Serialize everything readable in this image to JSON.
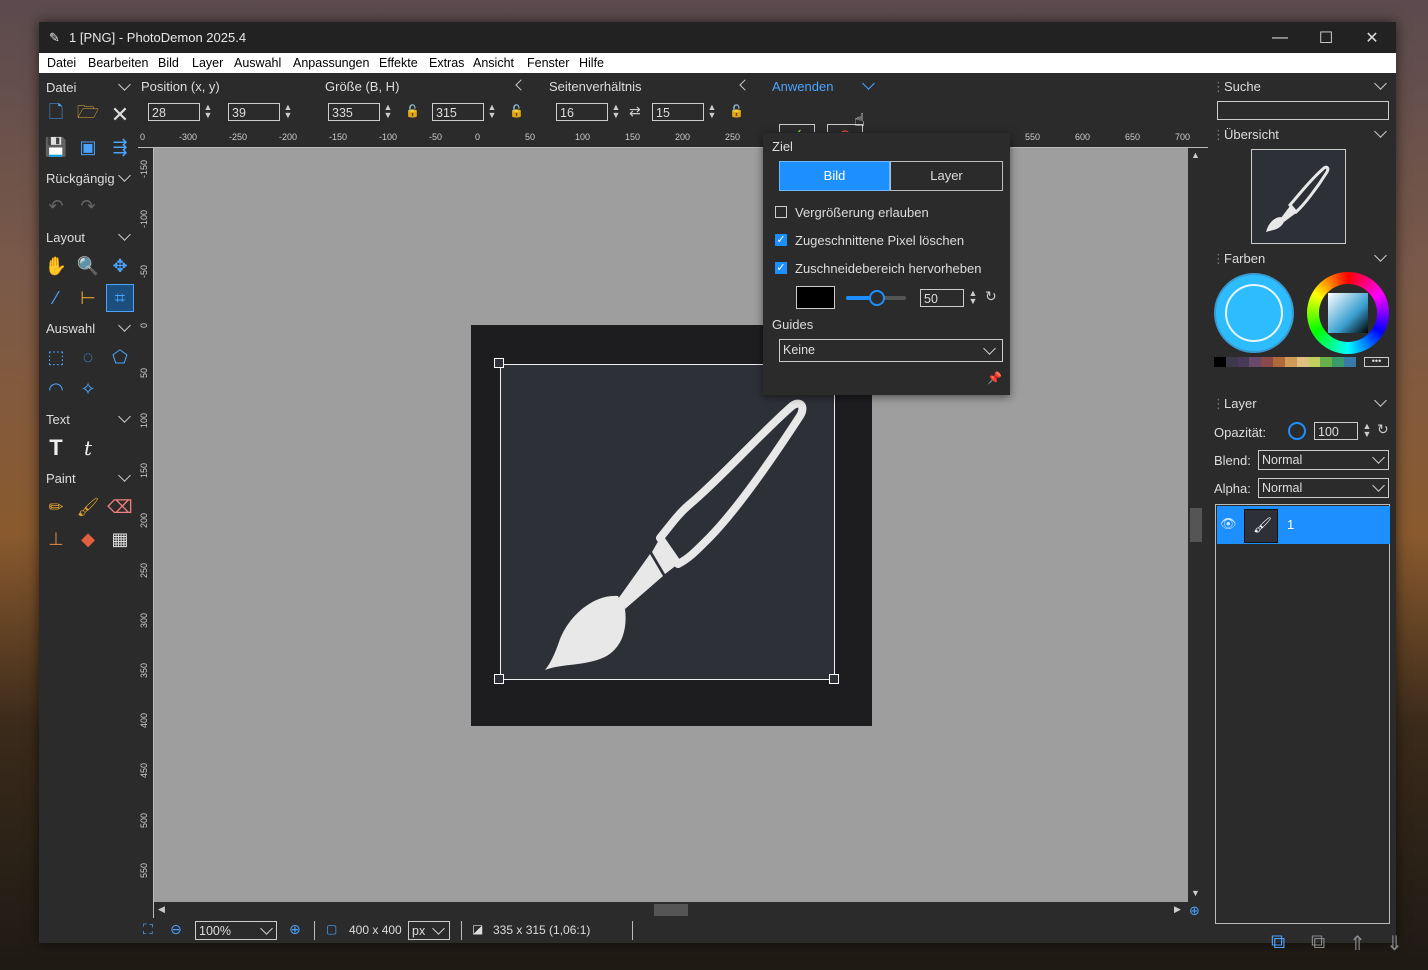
{
  "window": {
    "title": "1 [PNG]  -  PhotoDemon 2025.4"
  },
  "menu": [
    "Datei",
    "Bearbeiten",
    "Bild",
    "Layer",
    "Auswahl",
    "Anpassungen",
    "Effekte",
    "Extras",
    "Ansicht",
    "Fenster",
    "Hilfe"
  ],
  "toolbox": {
    "sections": {
      "datei": "Datei",
      "undo": "Rückgängig",
      "layout": "Layout",
      "auswahl": "Auswahl",
      "text": "Text",
      "paint": "Paint"
    }
  },
  "options": {
    "position_label": "Position (x, y)",
    "pos_x": "28",
    "pos_y": "39",
    "size_label": "Größe (B, H)",
    "size_w": "335",
    "size_h": "315",
    "ratio_label": "Seitenverhältnis",
    "ratio_a": "16",
    "ratio_b": "15",
    "apply_label": "Anwenden"
  },
  "popup": {
    "target_label": "Ziel",
    "target_bild": "Bild",
    "target_layer": "Layer",
    "allow_enlarge": "Vergrößerung erlauben",
    "delete_cropped": "Zugeschnittene Pixel löschen",
    "highlight": "Zuschneidebereich hervorheben",
    "highlight_opacity": "50",
    "guides_label": "Guides",
    "guides_value": "Keine"
  },
  "ruler": {
    "top": [
      "0",
      "-300",
      "-250",
      "-200",
      "-150",
      "-100",
      "-50",
      "0",
      "50",
      "100",
      "150",
      "200",
      "250",
      "550",
      "600",
      "650",
      "700"
    ],
    "left": [
      "-150",
      "-100",
      "-50",
      "0",
      "50",
      "100",
      "150",
      "200",
      "250",
      "300",
      "350",
      "400",
      "450",
      "500",
      "550"
    ]
  },
  "status": {
    "zoom": "100%",
    "image_size": "400 x 400",
    "unit": "px",
    "selection": "335 x 315  (1,06:1)"
  },
  "right_panel": {
    "search_label": "Suche",
    "overview_label": "Übersicht",
    "colors_label": "Farben",
    "layer_label": "Layer",
    "opacity_label": "Opazität:",
    "opacity_value": "100",
    "blend_label": "Blend:",
    "blend_value": "Normal",
    "alpha_label": "Alpha:",
    "alpha_value": "Normal",
    "layer_name": "1"
  },
  "colors": {
    "accent": "#1e8fff",
    "primary_color": "#2dbdff",
    "palette": [
      "#000000",
      "#3a3a4a",
      "#4a3a5a",
      "#6a4a6a",
      "#8a4a4a",
      "#b06a3a",
      "#d09a5a",
      "#e0c080",
      "#c0d060",
      "#6ab04a",
      "#3a9a6a",
      "#3a7aaa"
    ]
  }
}
